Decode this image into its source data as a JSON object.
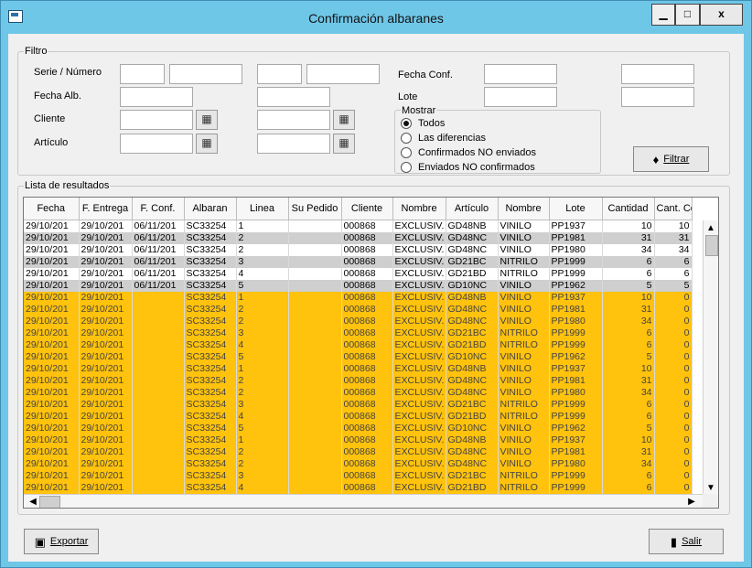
{
  "window": {
    "title": "Confirmación albaranes",
    "min_glyph": "▁",
    "max_glyph": "□",
    "close_glyph": "x"
  },
  "filter": {
    "group_title": "Filtro",
    "serie_numero_label": "Serie / Número",
    "fecha_alb_label": "Fecha Alb.",
    "cliente_label": "Cliente",
    "articulo_label": "Artículo",
    "fecha_conf_label": "Fecha Conf.",
    "lote_label": "Lote",
    "mostrar_title": "Mostrar",
    "options": [
      {
        "label": "Todos",
        "checked": true
      },
      {
        "label": "Las diferencias",
        "checked": false
      },
      {
        "label": "Confirmados NO enviados",
        "checked": false
      },
      {
        "label": "Enviados NO confirmados",
        "checked": false
      }
    ],
    "filter_button_label": "Filtrar"
  },
  "results": {
    "group_title": "Lista de resultados",
    "columns": [
      "Fecha",
      "F. Entrega",
      "F. Conf.",
      "Albaran",
      "Linea",
      "Su Pedido",
      "Cliente",
      "Nombre",
      "Artículo",
      "Nombre",
      "Lote",
      "Cantidad",
      "Cant. Co"
    ],
    "rows": [
      {
        "style": "white",
        "cells": [
          "29/10/201",
          "29/10/201",
          "06/11/201",
          "SC33254",
          "1",
          "",
          "000868",
          "EXCLUSIV.",
          "GD48NB",
          "VINILO",
          "PP1937",
          "10",
          "10"
        ]
      },
      {
        "style": "gray",
        "cells": [
          "29/10/201",
          "29/10/201",
          "06/11/201",
          "SC33254",
          "2",
          "",
          "000868",
          "EXCLUSIV.",
          "GD48NC",
          "VINILO",
          "PP1981",
          "31",
          "31"
        ]
      },
      {
        "style": "white",
        "cells": [
          "29/10/201",
          "29/10/201",
          "06/11/201",
          "SC33254",
          "2",
          "",
          "000868",
          "EXCLUSIV.",
          "GD48NC",
          "VINILO",
          "PP1980",
          "34",
          "34"
        ]
      },
      {
        "style": "gray",
        "cells": [
          "29/10/201",
          "29/10/201",
          "06/11/201",
          "SC33254",
          "3",
          "",
          "000868",
          "EXCLUSIV.",
          "GD21BC",
          "NITRILO",
          "PP1999",
          "6",
          "6"
        ]
      },
      {
        "style": "white",
        "cells": [
          "29/10/201",
          "29/10/201",
          "06/11/201",
          "SC33254",
          "4",
          "",
          "000868",
          "EXCLUSIV.",
          "GD21BD",
          "NITRILO",
          "PP1999",
          "6",
          "6"
        ]
      },
      {
        "style": "gray",
        "cells": [
          "29/10/201",
          "29/10/201",
          "06/11/201",
          "SC33254",
          "5",
          "",
          "000868",
          "EXCLUSIV.",
          "GD10NC",
          "VINILO",
          "PP1962",
          "5",
          "5"
        ]
      },
      {
        "style": "orange",
        "cells": [
          "29/10/201",
          "29/10/201",
          "",
          "SC33254",
          "1",
          "",
          "000868",
          "EXCLUSIV.",
          "GD48NB",
          "VINILO",
          "PP1937",
          "10",
          "0"
        ]
      },
      {
        "style": "orange",
        "cells": [
          "29/10/201",
          "29/10/201",
          "",
          "SC33254",
          "2",
          "",
          "000868",
          "EXCLUSIV.",
          "GD48NC",
          "VINILO",
          "PP1981",
          "31",
          "0"
        ]
      },
      {
        "style": "orange",
        "cells": [
          "29/10/201",
          "29/10/201",
          "",
          "SC33254",
          "2",
          "",
          "000868",
          "EXCLUSIV.",
          "GD48NC",
          "VINILO",
          "PP1980",
          "34",
          "0"
        ]
      },
      {
        "style": "orange",
        "cells": [
          "29/10/201",
          "29/10/201",
          "",
          "SC33254",
          "3",
          "",
          "000868",
          "EXCLUSIV.",
          "GD21BC",
          "NITRILO",
          "PP1999",
          "6",
          "0"
        ]
      },
      {
        "style": "orange",
        "cells": [
          "29/10/201",
          "29/10/201",
          "",
          "SC33254",
          "4",
          "",
          "000868",
          "EXCLUSIV.",
          "GD21BD",
          "NITRILO",
          "PP1999",
          "6",
          "0"
        ]
      },
      {
        "style": "orange",
        "cells": [
          "29/10/201",
          "29/10/201",
          "",
          "SC33254",
          "5",
          "",
          "000868",
          "EXCLUSIV.",
          "GD10NC",
          "VINILO",
          "PP1962",
          "5",
          "0"
        ]
      },
      {
        "style": "orange",
        "cells": [
          "29/10/201",
          "29/10/201",
          "",
          "SC33254",
          "1",
          "",
          "000868",
          "EXCLUSIV.",
          "GD48NB",
          "VINILO",
          "PP1937",
          "10",
          "0"
        ]
      },
      {
        "style": "orange",
        "cells": [
          "29/10/201",
          "29/10/201",
          "",
          "SC33254",
          "2",
          "",
          "000868",
          "EXCLUSIV.",
          "GD48NC",
          "VINILO",
          "PP1981",
          "31",
          "0"
        ]
      },
      {
        "style": "orange",
        "cells": [
          "29/10/201",
          "29/10/201",
          "",
          "SC33254",
          "2",
          "",
          "000868",
          "EXCLUSIV.",
          "GD48NC",
          "VINILO",
          "PP1980",
          "34",
          "0"
        ]
      },
      {
        "style": "orange",
        "cells": [
          "29/10/201",
          "29/10/201",
          "",
          "SC33254",
          "3",
          "",
          "000868",
          "EXCLUSIV.",
          "GD21BC",
          "NITRILO",
          "PP1999",
          "6",
          "0"
        ]
      },
      {
        "style": "orange",
        "cells": [
          "29/10/201",
          "29/10/201",
          "",
          "SC33254",
          "4",
          "",
          "000868",
          "EXCLUSIV.",
          "GD21BD",
          "NITRILO",
          "PP1999",
          "6",
          "0"
        ]
      },
      {
        "style": "orange",
        "cells": [
          "29/10/201",
          "29/10/201",
          "",
          "SC33254",
          "5",
          "",
          "000868",
          "EXCLUSIV.",
          "GD10NC",
          "VINILO",
          "PP1962",
          "5",
          "0"
        ]
      },
      {
        "style": "orange",
        "cells": [
          "29/10/201",
          "29/10/201",
          "",
          "SC33254",
          "1",
          "",
          "000868",
          "EXCLUSIV.",
          "GD48NB",
          "VINILO",
          "PP1937",
          "10",
          "0"
        ]
      },
      {
        "style": "orange",
        "cells": [
          "29/10/201",
          "29/10/201",
          "",
          "SC33254",
          "2",
          "",
          "000868",
          "EXCLUSIV.",
          "GD48NC",
          "VINILO",
          "PP1981",
          "31",
          "0"
        ]
      },
      {
        "style": "orange",
        "cells": [
          "29/10/201",
          "29/10/201",
          "",
          "SC33254",
          "2",
          "",
          "000868",
          "EXCLUSIV.",
          "GD48NC",
          "VINILO",
          "PP1980",
          "34",
          "0"
        ]
      },
      {
        "style": "orange",
        "cells": [
          "29/10/201",
          "29/10/201",
          "",
          "SC33254",
          "3",
          "",
          "000868",
          "EXCLUSIV.",
          "GD21BC",
          "NITRILO",
          "PP1999",
          "6",
          "0"
        ]
      },
      {
        "style": "orange",
        "cells": [
          "29/10/201",
          "29/10/201",
          "",
          "SC33254",
          "4",
          "",
          "000868",
          "EXCLUSIV.",
          "GD21BD",
          "NITRILO",
          "PP1999",
          "6",
          "0"
        ]
      }
    ]
  },
  "footer": {
    "export_label": "Exportar",
    "exit_label": "Salir"
  },
  "scrollbars": {
    "up": "▲",
    "down": "▼",
    "left": "◀",
    "right": "▶"
  },
  "icons": {
    "window": "app-window-icon",
    "binoculars": "binoculars-icon",
    "filter": "funnel-icon",
    "excel": "excel-icon",
    "exit": "door-icon"
  },
  "colors": {
    "highlight_row": "#ffc20d",
    "selected_gray_row": "#cfcfcf",
    "title_bar": "#6fc7e8"
  }
}
